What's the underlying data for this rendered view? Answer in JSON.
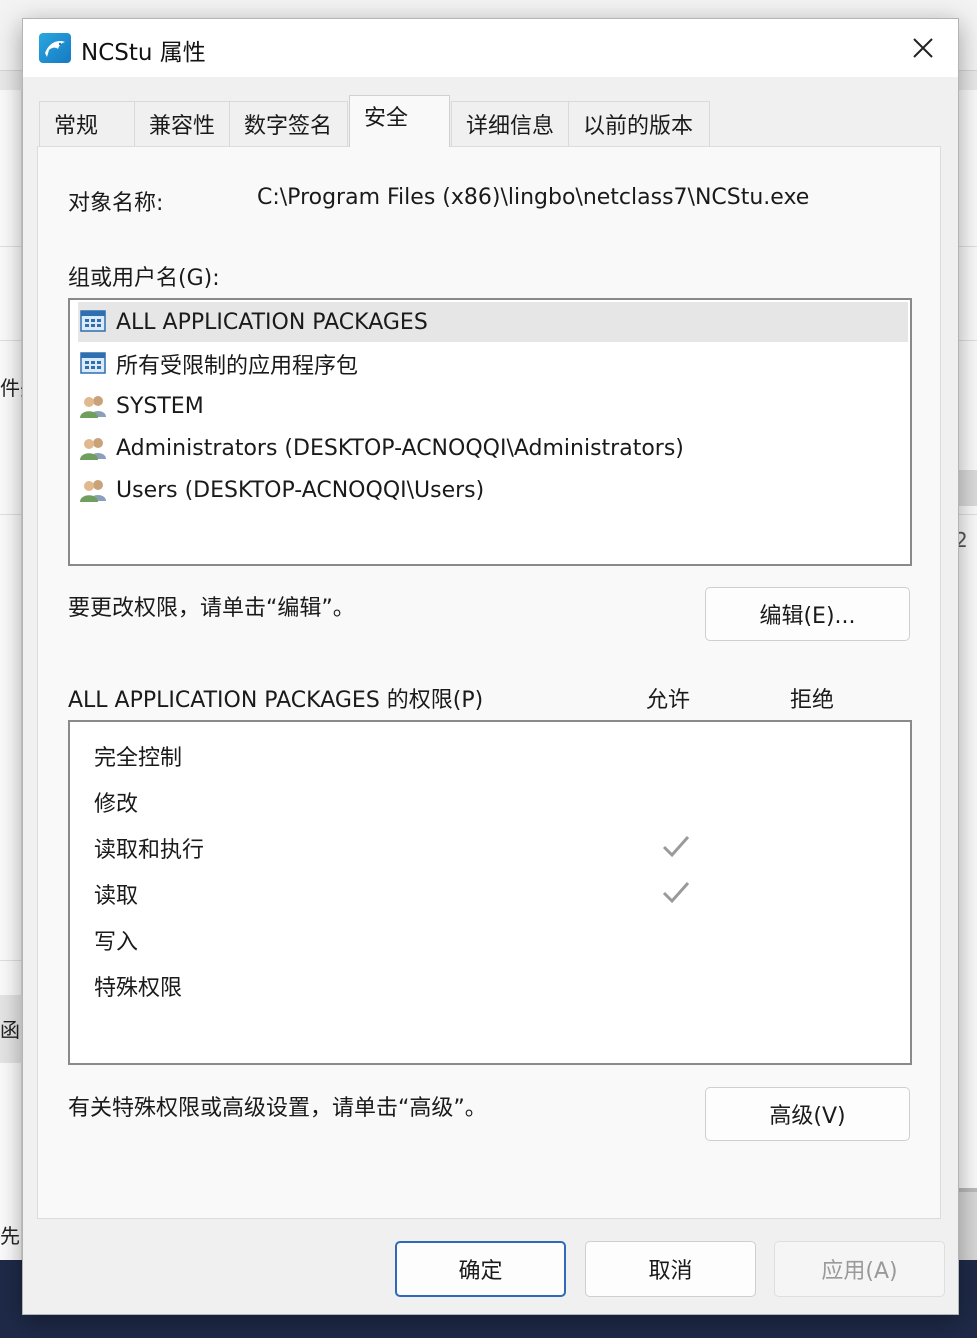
{
  "window": {
    "title": "NCStu 属性",
    "close_icon": "close-icon",
    "app_icon": "dolphin-app-icon"
  },
  "tabs": [
    {
      "label": "常规"
    },
    {
      "label": "兼容性"
    },
    {
      "label": "数字签名"
    },
    {
      "label": "安全",
      "active": true
    },
    {
      "label": "详细信息"
    },
    {
      "label": "以前的版本"
    }
  ],
  "security": {
    "object_name_label": "对象名称:",
    "object_name_value": "C:\\Program Files (x86)\\lingbo\\netclass7\\NCStu.exe",
    "groups_label": "组或用户名(G):",
    "groups": [
      {
        "name": "ALL APPLICATION PACKAGES",
        "icon": "app-package-icon",
        "selected": true
      },
      {
        "name": "所有受限制的应用程序包",
        "icon": "app-package-icon",
        "selected": false
      },
      {
        "name": "SYSTEM",
        "icon": "users-group-icon",
        "selected": false
      },
      {
        "name": "Administrators (DESKTOP-ACNOQQI\\Administrators)",
        "icon": "users-group-icon",
        "selected": false
      },
      {
        "name": "Users (DESKTOP-ACNOQQI\\Users)",
        "icon": "users-group-icon",
        "selected": false
      }
    ],
    "edit_hint": "要更改权限，请单击“编辑”。",
    "edit_button": "编辑(E)...",
    "permissions_label": "ALL APPLICATION PACKAGES 的权限(P)",
    "allow_header": "允许",
    "deny_header": "拒绝",
    "permissions": [
      {
        "name": "完全控制",
        "allow": false,
        "deny": false
      },
      {
        "name": "修改",
        "allow": false,
        "deny": false
      },
      {
        "name": "读取和执行",
        "allow": true,
        "deny": false
      },
      {
        "name": "读取",
        "allow": true,
        "deny": false
      },
      {
        "name": "写入",
        "allow": false,
        "deny": false
      },
      {
        "name": "特殊权限",
        "allow": false,
        "deny": false
      }
    ],
    "advanced_hint": "有关特殊权限或高级设置，请单击“高级”。",
    "advanced_button": "高级(V)"
  },
  "footer": {
    "ok": "确定",
    "cancel": "取消",
    "apply": "应用(A)"
  },
  "background": {
    "left_fragments": [
      "件头",
      "函",
      "先"
    ],
    "right_fragment": "2"
  },
  "colors": {
    "accent": "#2e6ab8",
    "check_gray": "#9a9a9a",
    "taskbar": "#1e2a48"
  }
}
